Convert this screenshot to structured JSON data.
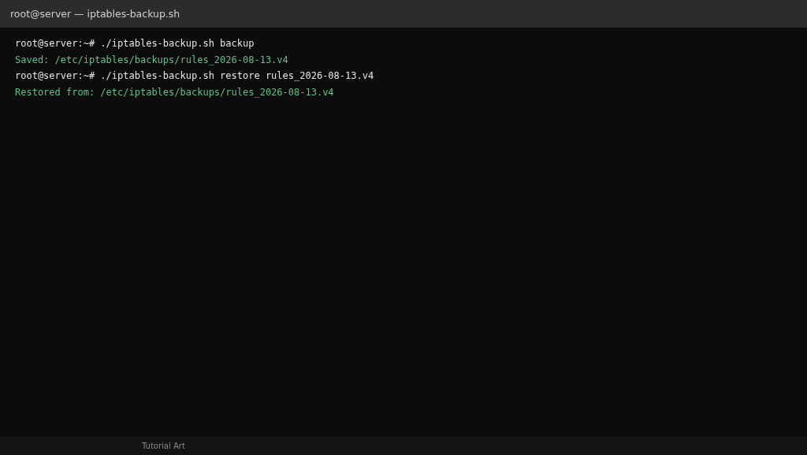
{
  "window": {
    "title": "root@server — iptables-backup.sh"
  },
  "terminal": {
    "lines": [
      {
        "kind": "command",
        "text": "root@server:~# ./iptables-backup.sh backup"
      },
      {
        "kind": "output",
        "text": "Saved: /etc/iptables/backups/rules_2026-08-13.v4"
      },
      {
        "kind": "command",
        "text": "root@server:~# ./iptables-backup.sh restore rules_2026-08-13.v4"
      },
      {
        "kind": "output",
        "text": "Restored from: /etc/iptables/backups/rules_2026-08-13.v4"
      }
    ]
  },
  "status_bar": {
    "text": "Tutorial Art"
  }
}
